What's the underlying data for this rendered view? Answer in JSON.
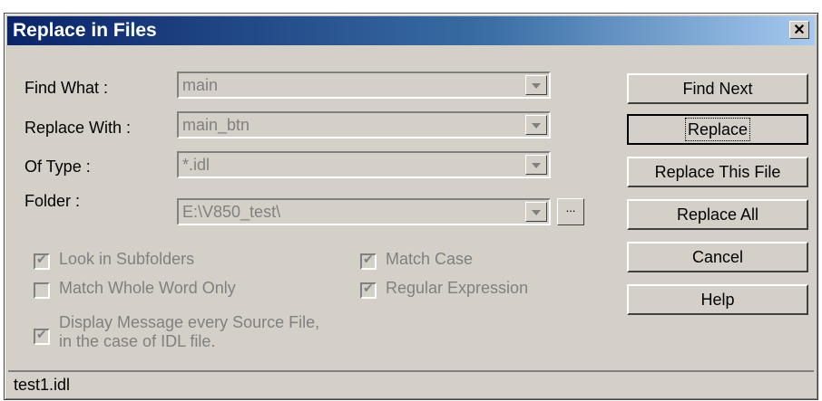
{
  "dialog": {
    "title": "Replace in Files",
    "close_label": "✕"
  },
  "fields": {
    "find_what": {
      "label": "Find What :",
      "value": "main"
    },
    "replace_with": {
      "label": "Replace With :",
      "value": "main_btn"
    },
    "of_type": {
      "label": "Of Type :",
      "value": "*.idl"
    },
    "folder": {
      "label": "Folder :",
      "value": "E:\\V850_test\\",
      "browse_label": "..."
    }
  },
  "buttons": {
    "find_next": "Find Next",
    "replace": "Replace",
    "replace_this_file": "Replace This File",
    "replace_all": "Replace All",
    "cancel": "Cancel",
    "help": "Help"
  },
  "options": {
    "look_in_subfolders": {
      "label": "Look in Subfolders",
      "checked": true
    },
    "match_whole_word": {
      "label": "Match Whole Word Only",
      "checked": false
    },
    "match_case": {
      "label": "Match Case",
      "checked": true
    },
    "regular_expression": {
      "label": "Regular Expression",
      "checked": true
    },
    "display_message": {
      "label_line1": "Display Message every Source File,",
      "label_line2": "in the case of IDL file.",
      "checked": true
    }
  },
  "status": {
    "text": "test1.idl"
  }
}
